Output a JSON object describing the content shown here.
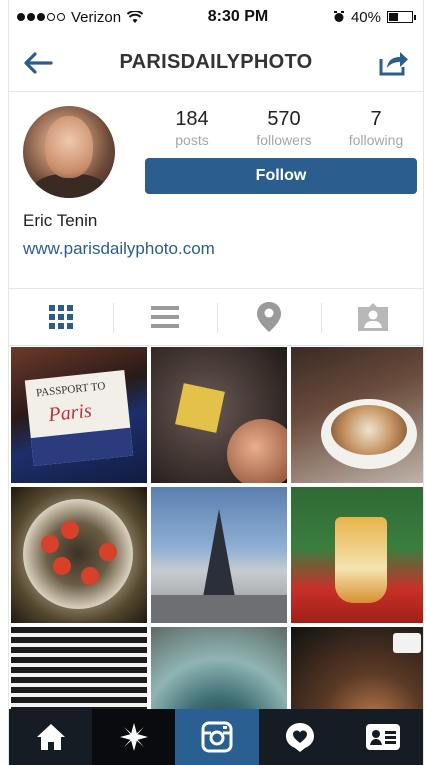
{
  "status_bar": {
    "carrier": "Verizon",
    "time": "8:30 PM",
    "battery_percent": "40%",
    "battery_level": 0.4,
    "signal_dots_filled": 3,
    "signal_dots_total": 5
  },
  "header": {
    "title": "PARISDAILYPHOTO",
    "back_icon": "arrow-left-icon",
    "share_icon": "share-icon"
  },
  "profile": {
    "name": "Eric Tenin",
    "website": "www.parisdailyphoto.com",
    "stats": [
      {
        "value": "184",
        "label": "posts"
      },
      {
        "value": "570",
        "label": "followers"
      },
      {
        "value": "7",
        "label": "following"
      }
    ],
    "follow_label": "Follow"
  },
  "view_tabs": [
    {
      "icon": "grid-icon",
      "active": true
    },
    {
      "icon": "list-icon",
      "active": false
    },
    {
      "icon": "location-pin-icon",
      "active": false
    },
    {
      "icon": "tagged-person-icon",
      "active": false
    }
  ],
  "photo_grid_texts": {
    "passport": "PASSPORT TO",
    "paris": "Paris"
  },
  "bottom_tabs": [
    {
      "icon": "home-icon"
    },
    {
      "icon": "explore-icon"
    },
    {
      "icon": "camera-icon",
      "active": true
    },
    {
      "icon": "activity-icon"
    },
    {
      "icon": "profile-card-icon"
    }
  ],
  "colors": {
    "accent": "#2b5d8f",
    "tabbar": "#161c24",
    "muted": "#a6a6a6"
  }
}
